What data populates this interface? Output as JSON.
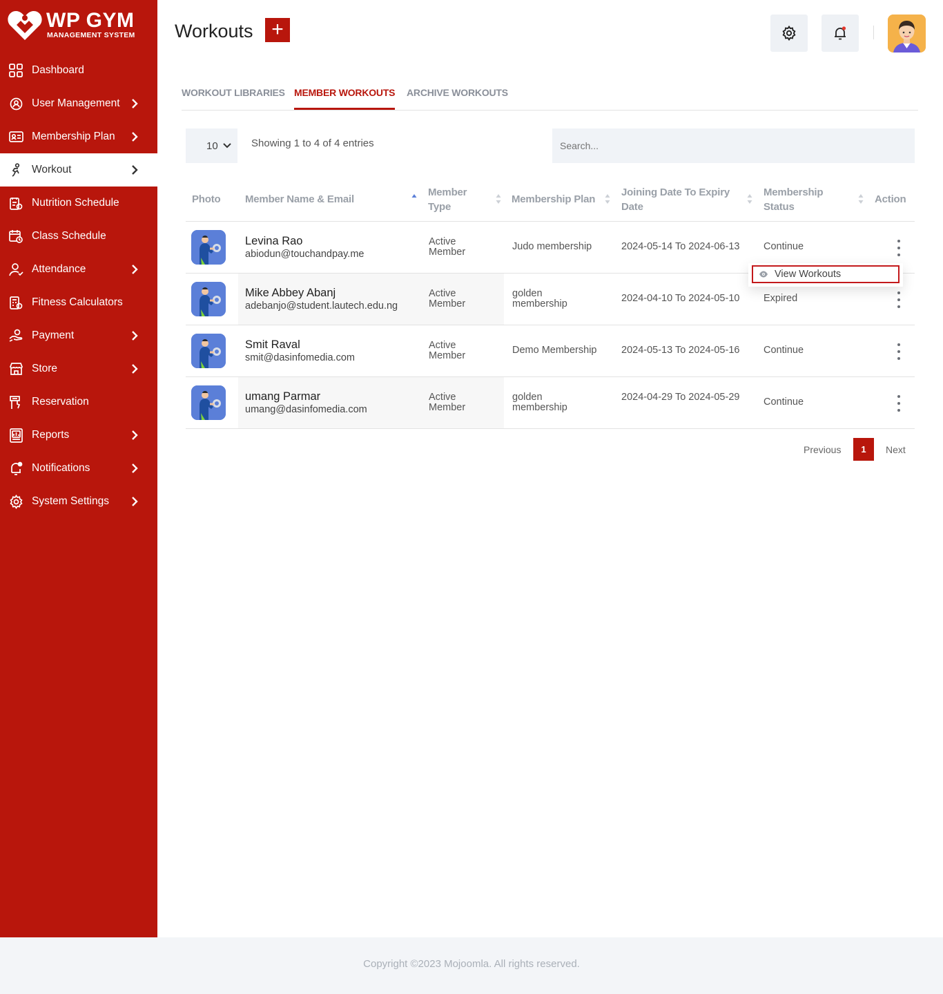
{
  "brand": {
    "name": "WP GYM",
    "tagline": "MANAGEMENT SYSTEM",
    "color": "#b8160c"
  },
  "sidebar": {
    "items": [
      {
        "label": "Dashboard",
        "icon": "dashboard-icon",
        "has_submenu": false,
        "active": false
      },
      {
        "label": "User Management",
        "icon": "users-gear-icon",
        "has_submenu": true,
        "active": false
      },
      {
        "label": "Membership Plan",
        "icon": "membership-card-icon",
        "has_submenu": true,
        "active": false
      },
      {
        "label": "Workout",
        "icon": "workout-icon",
        "has_submenu": true,
        "active": true
      },
      {
        "label": "Nutrition Schedule",
        "icon": "nutrition-icon",
        "has_submenu": false,
        "active": false
      },
      {
        "label": "Class Schedule",
        "icon": "calendar-icon",
        "has_submenu": false,
        "active": false
      },
      {
        "label": "Attendance",
        "icon": "attendance-icon",
        "has_submenu": true,
        "active": false
      },
      {
        "label": "Fitness Calculators",
        "icon": "calculator-icon",
        "has_submenu": false,
        "active": false
      },
      {
        "label": "Payment",
        "icon": "payment-icon",
        "has_submenu": true,
        "active": false
      },
      {
        "label": "Store",
        "icon": "store-icon",
        "has_submenu": true,
        "active": false
      },
      {
        "label": "Reservation",
        "icon": "reservation-icon",
        "has_submenu": false,
        "active": false
      },
      {
        "label": "Reports",
        "icon": "reports-icon",
        "has_submenu": true,
        "active": false
      },
      {
        "label": "Notifications",
        "icon": "bell-icon",
        "has_submenu": true,
        "active": false
      },
      {
        "label": "System Settings",
        "icon": "gear-icon",
        "has_submenu": true,
        "active": false
      }
    ]
  },
  "header": {
    "title": "Workouts",
    "add_symbol": "+"
  },
  "tabs": [
    {
      "label": "WORKOUT LIBRARIES",
      "active": false
    },
    {
      "label": "MEMBER WORKOUTS",
      "active": true
    },
    {
      "label": "ARCHIVE WORKOUTS",
      "active": false
    }
  ],
  "controls": {
    "page_length": "10",
    "info": "Showing 1 to 4 of 4 entries",
    "search_placeholder": "Search..."
  },
  "table": {
    "columns": {
      "photo": "Photo",
      "name": "Member Name & Email",
      "type": "Member Type",
      "plan": "Membership Plan",
      "dates": "Joining Date To Expiry Date",
      "status": "Membership Status",
      "action": "Action"
    },
    "rows": [
      {
        "name": "Levina Rao",
        "email": "abiodun@touchandpay.me",
        "type": "Active Member",
        "plan": "Judo membership",
        "dates": "2024-05-14 To 2024-06-13",
        "status": "Continue"
      },
      {
        "name": "Mike Abbey Abanj",
        "email": "adebanjo@student.lautech.edu.ng",
        "type": "Active Member",
        "plan": "golden membership",
        "dates": "2024-04-10 To 2024-05-10",
        "status": "Expired"
      },
      {
        "name": "Smit Raval",
        "email": "smit@dasinfomedia.com",
        "type": "Active Member",
        "plan": "Demo Membership",
        "dates": "2024-05-13 To 2024-05-16",
        "status": "Continue"
      },
      {
        "name": "umang Parmar",
        "email": "umang@dasinfomedia.com",
        "type": "Active Member",
        "plan": "golden membership",
        "dates": "2024-04-29 To 2024-05-29",
        "status": "Continue"
      }
    ]
  },
  "dropdown": {
    "item_label": "View Workouts"
  },
  "pagination": {
    "previous": "Previous",
    "current": "1",
    "next": "Next"
  },
  "footer": {
    "copyright": "Copyright ©2023 Mojoomla. All rights reserved."
  }
}
